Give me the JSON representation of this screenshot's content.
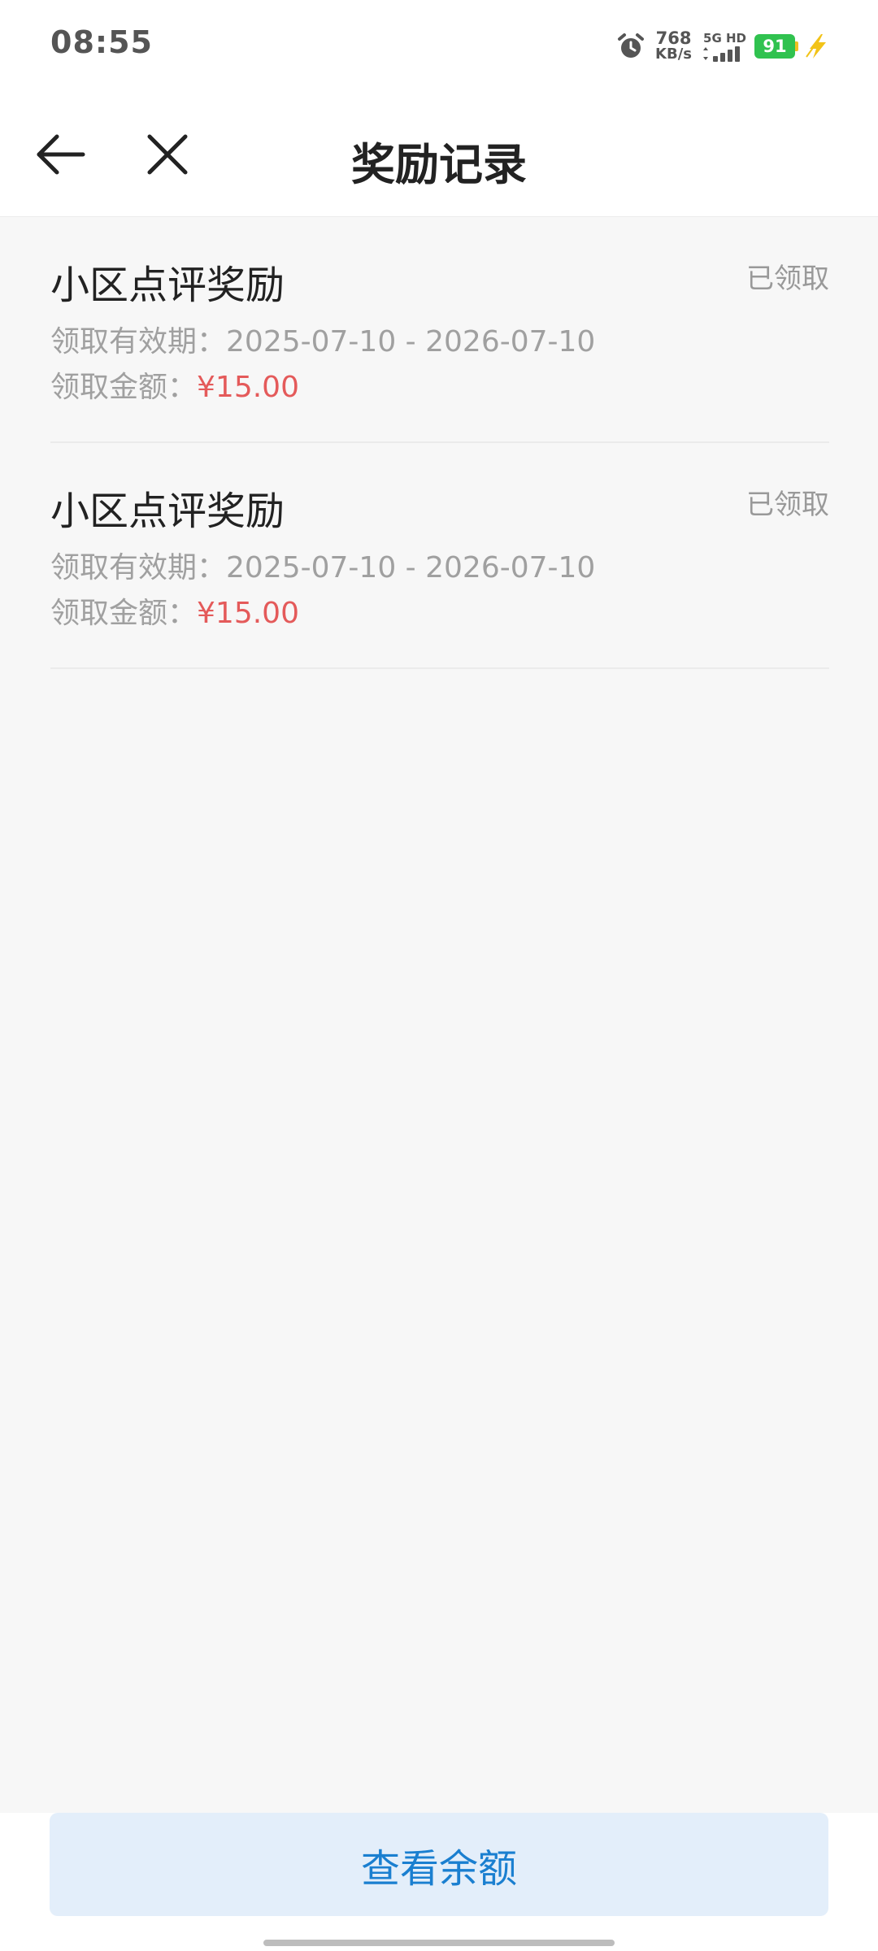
{
  "status_bar": {
    "time": "08:55",
    "net_speed_value": "768",
    "net_speed_unit": "KB/s",
    "network_type": "5G HD",
    "battery_level": "91",
    "icons": [
      "alarm-icon",
      "signal-icon",
      "battery-icon",
      "charging-icon"
    ]
  },
  "header": {
    "title": "奖励记录",
    "back_icon": "back-arrow-icon",
    "close_icon": "close-icon"
  },
  "records": [
    {
      "title": "小区点评奖励",
      "status": "已领取",
      "validity_label": "领取有效期：",
      "validity_range": "2025-07-10 - 2026-07-10",
      "amount_label": "领取金额：",
      "amount": "¥15.00"
    },
    {
      "title": "小区点评奖励",
      "status": "已领取",
      "validity_label": "领取有效期：",
      "validity_range": "2025-07-10 - 2026-07-10",
      "amount_label": "领取金额：",
      "amount": "¥15.00"
    }
  ],
  "bottom": {
    "balance_button": "查看余额"
  },
  "colors": {
    "accent": "#1a7fd0",
    "amount": "#e45a5a",
    "button_bg": "#e3eefa",
    "page_bg": "#f7f7f7"
  }
}
